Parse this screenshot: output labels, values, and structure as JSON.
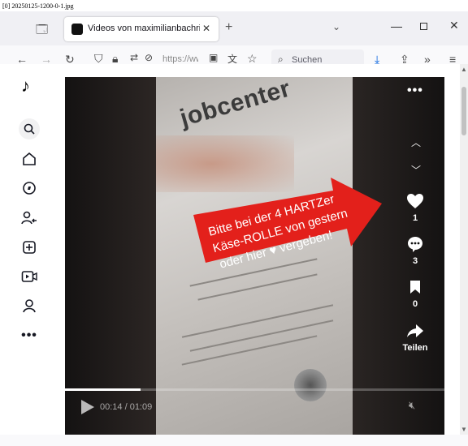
{
  "caption": "[0] 20250125-1200-0-1.jpg",
  "tab": {
    "title": "Videos von maximilianbachring"
  },
  "navbar": {
    "url": "https://ww",
    "search_placeholder": "Suchen"
  },
  "video": {
    "overlay_line1": "Bitte bei der 4 HARTZer",
    "overlay_line2": "Käse-ROLLE von gestern",
    "overlay_line3": "oder hier ♥ vergeben!",
    "doc_logo": "jobcenter",
    "time": "00:14 / 01:09",
    "progress": 0.2,
    "likes": "1",
    "comments": "3",
    "bookmarks": "0",
    "share_label": "Teilen"
  },
  "colors": {
    "banner_red": "#e3201b",
    "tiktok_black": "#000000"
  }
}
